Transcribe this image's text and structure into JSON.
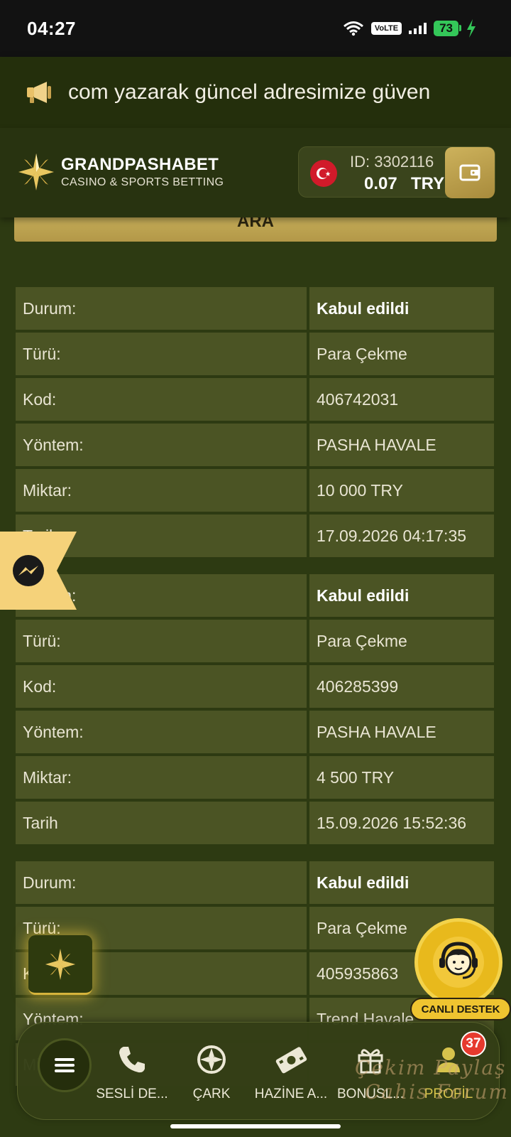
{
  "status_bar": {
    "time": "04:27",
    "volte": "VoLTE",
    "battery": "73"
  },
  "announcement": {
    "text": "com yazarak güncel adresimize güven"
  },
  "header": {
    "logo_title": "GRANDPASHABET",
    "logo_subtitle": "CASINO & SPORTS BETTING",
    "account_id": "ID: 3302116",
    "balance": "0.07",
    "currency": "TRY"
  },
  "search": {
    "label": "ARA"
  },
  "labels": {
    "status": "Durum:",
    "type": "Türü:",
    "code": "Kod:",
    "method": "Yöntem:",
    "amount": "Miktar:",
    "date": "Tarih"
  },
  "transactions": [
    {
      "status": "Kabul edildi",
      "type": "Para Çekme",
      "code": "406742031",
      "method": "PASHA HAVALE",
      "amount": "10 000 TRY",
      "date": "17.09.2026 04:17:35"
    },
    {
      "status": "Kabul edildi",
      "type": "Para Çekme",
      "code": "406285399",
      "method": "PASHA HAVALE",
      "amount": "4 500 TRY",
      "date": "15.09.2026 15:52:36"
    },
    {
      "status": "Kabul edildi",
      "type": "Para Çekme",
      "code": "405935863",
      "method": "Trend Havale",
      "amount": "",
      "date": ""
    }
  ],
  "live_support": {
    "label": "CANLI DESTEK"
  },
  "bottom_nav": {
    "items": [
      {
        "label": "SESLİ DE...",
        "icon": "phone-icon"
      },
      {
        "label": "ÇARK",
        "icon": "wheel-icon"
      },
      {
        "label": "HAZİNE A...",
        "icon": "cash-icon"
      },
      {
        "label": "BONUSL...",
        "icon": "gift-icon"
      },
      {
        "label": "PROFİL",
        "icon": "profile-icon",
        "badge": "37"
      }
    ]
  },
  "watermark": {
    "line1": "Çekim Paylaş",
    "line2": "Cahis Forum"
  },
  "colors": {
    "background": "#2d3a12",
    "cell": "#4b5424",
    "gold": "#cbb45e",
    "accent": "#d7c34c"
  }
}
